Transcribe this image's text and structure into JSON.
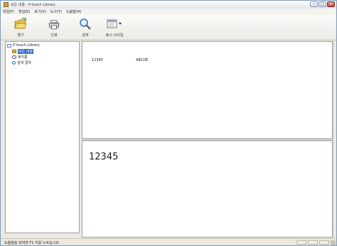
{
  "window": {
    "title": "모든 내용 - P-touch Library",
    "controls": {
      "minimize": "–",
      "maximize": "□",
      "close": "×"
    }
  },
  "menu": [
    "파일(F)",
    "편집(E)",
    "보기(V)",
    "도구(T)",
    "도움말(H)"
  ],
  "toolbar": {
    "open_label": "열기",
    "print_label": "인쇄",
    "search_label": "검색",
    "display_style_label": "표시 스타일"
  },
  "tree": {
    "root": "P-touch Library",
    "items": [
      {
        "label": "모든 내용",
        "selected": true
      },
      {
        "label": "휴지통",
        "selected": false
      },
      {
        "label": "검색 결과",
        "selected": false
      }
    ]
  },
  "list": {
    "row1": {
      "col1": "12345",
      "col2": "ABCDE"
    }
  },
  "preview": {
    "text": "12345"
  },
  "status": {
    "text": "도움말을 보려면 F1 키를 누르십시오."
  },
  "colors": {
    "selection": "#3169c6",
    "folder": "#d9b14a",
    "titlebar_close": "#c5473a"
  }
}
